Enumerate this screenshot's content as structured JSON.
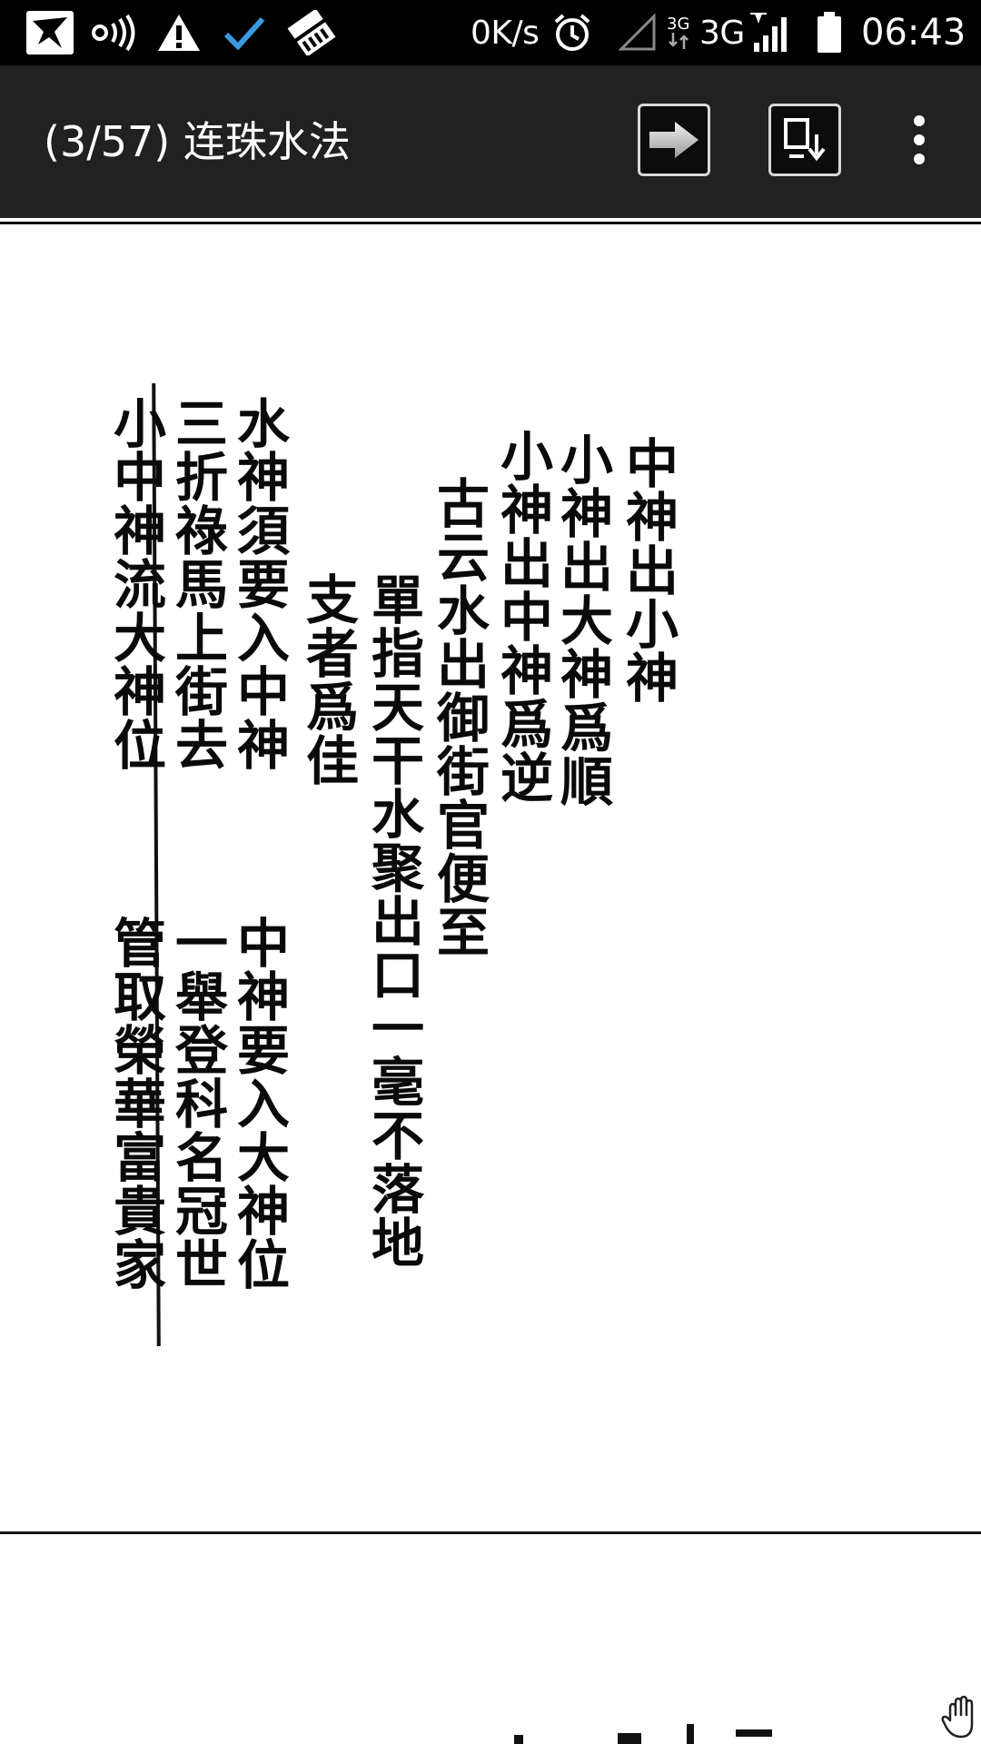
{
  "status_bar": {
    "network_speed": "0K/s",
    "network_type": "3G",
    "network_type_small": "3G",
    "time": "06:43",
    "icons": [
      "notification-bird-icon",
      "hotspot-icon",
      "warning-icon",
      "check-icon",
      "cleaner-icon",
      "alarm-icon",
      "signal-empty-icon",
      "data-arrows-icon",
      "signal-full-icon",
      "battery-icon"
    ]
  },
  "app_bar": {
    "title": "(3/57) 连珠水法",
    "actions": [
      "next-page-icon",
      "save-page-icon",
      "overflow-menu-icon"
    ]
  },
  "page": {
    "columns": [
      "中神出小神",
      "小神出大神爲順",
      "小神出中神爲逆",
      "古云水出御街官便至",
      "單指天干水聚出口一毫不落地",
      "支者爲佳",
      "水神須要入中神",
      "三折祿馬上街去",
      "小中神流大神位",
      "中神要入大神位",
      "一舉登科名冠世",
      "管取榮華富貴家"
    ],
    "accent_colors": {
      "status_bar_bg": "#000000",
      "app_bar_bg": "#212121",
      "check_blue": "#3a9be0",
      "ink": "#0a0a0a"
    }
  }
}
